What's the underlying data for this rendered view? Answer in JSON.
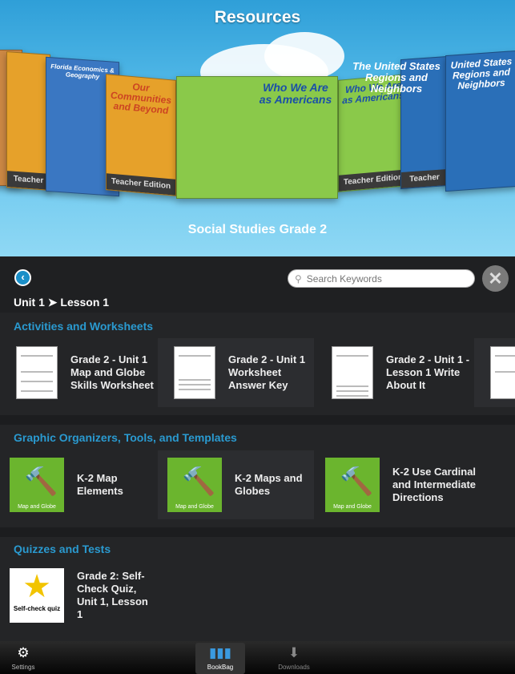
{
  "header": {
    "title": "Resources",
    "selected_label": "Social Studies Grade 2"
  },
  "covers": [
    {
      "title": "Our Communities and Beyond",
      "edition": "Teacher Edition",
      "color": "#e6a12a"
    },
    {
      "title": "Florida Economics & Geography",
      "edition": "",
      "color": "#3a77c2"
    },
    {
      "title": "Our Communities and Beyond",
      "edition": "Teacher Edition",
      "color": "#e6a12a"
    },
    {
      "title": "Who We Are as Americans",
      "edition": "",
      "color": "#8ac94a"
    },
    {
      "title": "Who We Are as Americans",
      "edition": "Teacher Edition",
      "color": "#8ac94a"
    },
    {
      "title": "The United States Regions and Neighbors",
      "edition": "Teacher Edition",
      "color": "#2a6fb8"
    },
    {
      "title": "United States Regions and Neighbors",
      "edition": "",
      "color": "#2a6fb8"
    }
  ],
  "panel": {
    "search_placeholder": "Search Keywords",
    "breadcrumb": "Unit 1 ➤ Lesson 1",
    "sections": [
      {
        "title": "Activities and Worksheets",
        "items": [
          "Grade 2 - Unit 1 Map and Globe Skills Worksheet",
          "Grade 2 - Unit 1 Worksheet Answer Key",
          "Grade 2 - Unit 1 - Lesson 1 Write About It"
        ]
      },
      {
        "title": "Graphic Organizers, Tools, and Templates",
        "thumb_caption": "Map and Globe",
        "items": [
          "K-2 Map Elements",
          "K-2 Maps and Globes",
          "K-2 Use Cardinal and Intermediate Directions"
        ]
      },
      {
        "title": "Quizzes and Tests",
        "thumb_caption": "Self-check quiz",
        "items": [
          "Grade 2: Self-Check Quiz, Unit 1, Lesson 1"
        ]
      }
    ]
  },
  "tabbar": {
    "settings": "Settings",
    "bookbag": "BookBag",
    "downloads": "Downloads",
    "selected": "BookBag"
  },
  "colors": {
    "accent": "#2a9ad0",
    "sky": "#5cc0ec",
    "panel": "#242527"
  }
}
